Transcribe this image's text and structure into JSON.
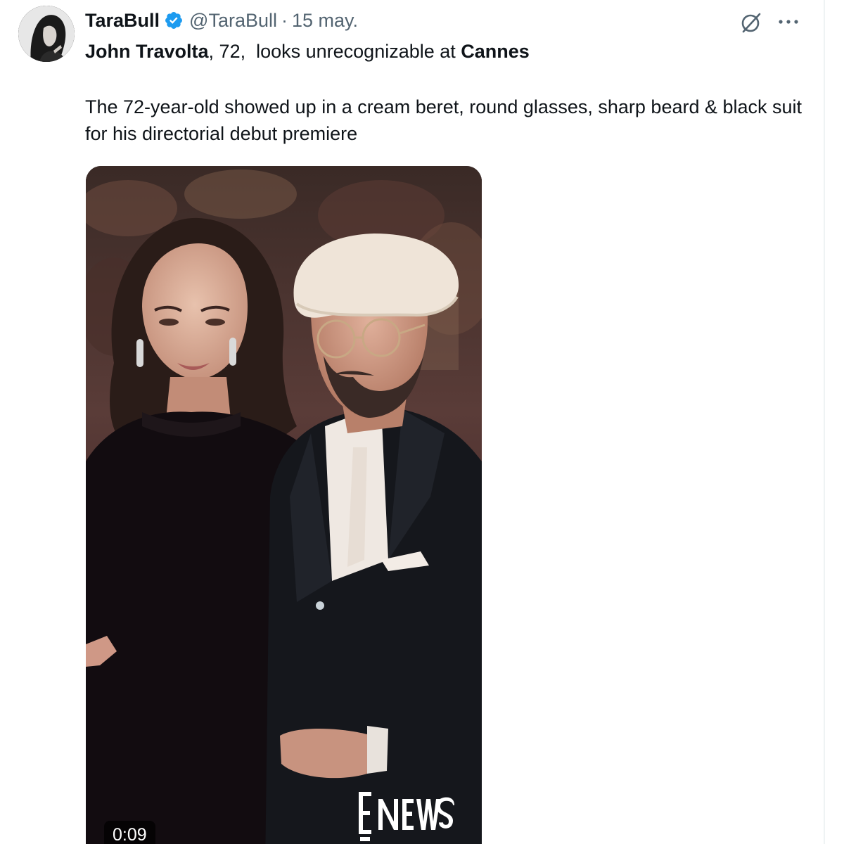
{
  "tweet": {
    "author": {
      "display_name": "TaraBull",
      "handle": "@TaraBull",
      "verified": true,
      "verified_color": "#1d9bf0",
      "avatar_icon": "avatar-photo"
    },
    "separator": "·",
    "timestamp": "15 may.",
    "headline": {
      "part1_bold": "John Travolta",
      "part2": ", 72,  looks unrecognizable at ",
      "part3_bold": "Cannes"
    },
    "body": "The 72-year-old showed up in a cream beret, round glasses, sharp beard & black suit for his directorial debut premiere",
    "media": {
      "type": "video",
      "duration": "0:09",
      "watermark": "E NEWS"
    },
    "actions": {
      "grok_icon": "grok-icon",
      "more_icon": "more-dots-icon"
    }
  },
  "colors": {
    "text_primary": "#0f1419",
    "text_secondary": "#536471",
    "accent": "#1d9bf0",
    "border": "#eff3f4"
  }
}
